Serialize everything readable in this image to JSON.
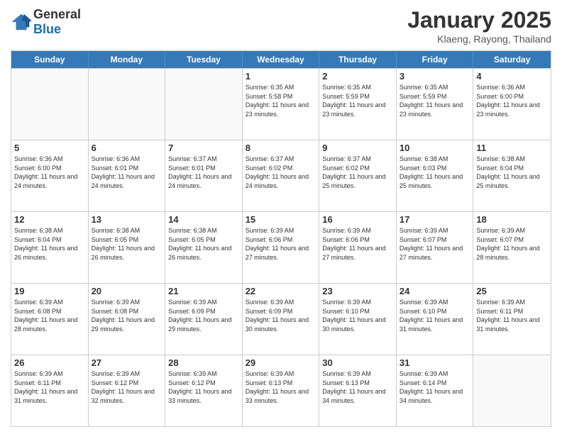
{
  "header": {
    "logo_general": "General",
    "logo_blue": "Blue",
    "month_title": "January 2025",
    "location": "Klaeng, Rayong, Thailand"
  },
  "days_of_week": [
    "Sunday",
    "Monday",
    "Tuesday",
    "Wednesday",
    "Thursday",
    "Friday",
    "Saturday"
  ],
  "weeks": [
    [
      {
        "day": "",
        "empty": true
      },
      {
        "day": "",
        "empty": true
      },
      {
        "day": "",
        "empty": true
      },
      {
        "day": "1",
        "sunrise": "6:35 AM",
        "sunset": "5:58 PM",
        "daylight": "11 hours and 23 minutes."
      },
      {
        "day": "2",
        "sunrise": "6:35 AM",
        "sunset": "5:59 PM",
        "daylight": "11 hours and 23 minutes."
      },
      {
        "day": "3",
        "sunrise": "6:35 AM",
        "sunset": "5:59 PM",
        "daylight": "11 hours and 23 minutes."
      },
      {
        "day": "4",
        "sunrise": "6:36 AM",
        "sunset": "6:00 PM",
        "daylight": "11 hours and 23 minutes."
      }
    ],
    [
      {
        "day": "5",
        "sunrise": "6:36 AM",
        "sunset": "6:00 PM",
        "daylight": "11 hours and 24 minutes."
      },
      {
        "day": "6",
        "sunrise": "6:36 AM",
        "sunset": "6:01 PM",
        "daylight": "11 hours and 24 minutes."
      },
      {
        "day": "7",
        "sunrise": "6:37 AM",
        "sunset": "6:01 PM",
        "daylight": "11 hours and 24 minutes."
      },
      {
        "day": "8",
        "sunrise": "6:37 AM",
        "sunset": "6:02 PM",
        "daylight": "11 hours and 24 minutes."
      },
      {
        "day": "9",
        "sunrise": "6:37 AM",
        "sunset": "6:02 PM",
        "daylight": "11 hours and 25 minutes."
      },
      {
        "day": "10",
        "sunrise": "6:38 AM",
        "sunset": "6:03 PM",
        "daylight": "11 hours and 25 minutes."
      },
      {
        "day": "11",
        "sunrise": "6:38 AM",
        "sunset": "6:04 PM",
        "daylight": "11 hours and 25 minutes."
      }
    ],
    [
      {
        "day": "12",
        "sunrise": "6:38 AM",
        "sunset": "6:04 PM",
        "daylight": "11 hours and 26 minutes."
      },
      {
        "day": "13",
        "sunrise": "6:38 AM",
        "sunset": "6:05 PM",
        "daylight": "11 hours and 26 minutes."
      },
      {
        "day": "14",
        "sunrise": "6:38 AM",
        "sunset": "6:05 PM",
        "daylight": "11 hours and 26 minutes."
      },
      {
        "day": "15",
        "sunrise": "6:39 AM",
        "sunset": "6:06 PM",
        "daylight": "11 hours and 27 minutes."
      },
      {
        "day": "16",
        "sunrise": "6:39 AM",
        "sunset": "6:06 PM",
        "daylight": "11 hours and 27 minutes."
      },
      {
        "day": "17",
        "sunrise": "6:39 AM",
        "sunset": "6:07 PM",
        "daylight": "11 hours and 27 minutes."
      },
      {
        "day": "18",
        "sunrise": "6:39 AM",
        "sunset": "6:07 PM",
        "daylight": "11 hours and 28 minutes."
      }
    ],
    [
      {
        "day": "19",
        "sunrise": "6:39 AM",
        "sunset": "6:08 PM",
        "daylight": "11 hours and 28 minutes."
      },
      {
        "day": "20",
        "sunrise": "6:39 AM",
        "sunset": "6:08 PM",
        "daylight": "11 hours and 29 minutes."
      },
      {
        "day": "21",
        "sunrise": "6:39 AM",
        "sunset": "6:09 PM",
        "daylight": "11 hours and 29 minutes."
      },
      {
        "day": "22",
        "sunrise": "6:39 AM",
        "sunset": "6:09 PM",
        "daylight": "11 hours and 30 minutes."
      },
      {
        "day": "23",
        "sunrise": "6:39 AM",
        "sunset": "6:10 PM",
        "daylight": "11 hours and 30 minutes."
      },
      {
        "day": "24",
        "sunrise": "6:39 AM",
        "sunset": "6:10 PM",
        "daylight": "11 hours and 31 minutes."
      },
      {
        "day": "25",
        "sunrise": "6:39 AM",
        "sunset": "6:11 PM",
        "daylight": "11 hours and 31 minutes."
      }
    ],
    [
      {
        "day": "26",
        "sunrise": "6:39 AM",
        "sunset": "6:11 PM",
        "daylight": "11 hours and 31 minutes."
      },
      {
        "day": "27",
        "sunrise": "6:39 AM",
        "sunset": "6:12 PM",
        "daylight": "11 hours and 32 minutes."
      },
      {
        "day": "28",
        "sunrise": "6:39 AM",
        "sunset": "6:12 PM",
        "daylight": "11 hours and 33 minutes."
      },
      {
        "day": "29",
        "sunrise": "6:39 AM",
        "sunset": "6:13 PM",
        "daylight": "11 hours and 33 minutes."
      },
      {
        "day": "30",
        "sunrise": "6:39 AM",
        "sunset": "6:13 PM",
        "daylight": "11 hours and 34 minutes."
      },
      {
        "day": "31",
        "sunrise": "6:39 AM",
        "sunset": "6:14 PM",
        "daylight": "11 hours and 34 minutes."
      },
      {
        "day": "",
        "empty": true
      }
    ]
  ],
  "labels": {
    "sunrise": "Sunrise:",
    "sunset": "Sunset:",
    "daylight": "Daylight:"
  }
}
